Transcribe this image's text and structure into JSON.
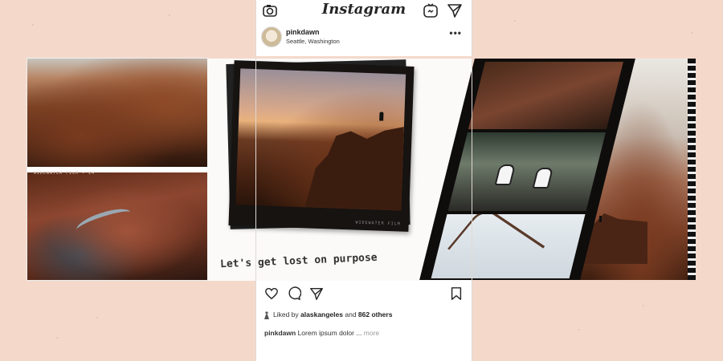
{
  "instagram": {
    "logo": "Instagram",
    "icons": {
      "camera": "camera-icon",
      "igtv": "igtv-icon",
      "direct": "direct-message-icon"
    },
    "post": {
      "username": "pinkdawn",
      "location": "Seattle, Washington",
      "more": "•••"
    },
    "actions": {
      "like": "heart-icon",
      "comment": "comment-icon",
      "share": "send-icon",
      "save": "bookmark-icon"
    },
    "likes": {
      "prefix": "Liked by",
      "user": "alaskangeles",
      "joiner": "and",
      "others": "862 others"
    },
    "caption": {
      "username": "pinkdawn",
      "text": "Lorem ipsum dolor ...",
      "more": "more"
    }
  },
  "collage": {
    "tagline": "Let's get lost on purpose",
    "film_caption": "WIDEWATER FILM • 24",
    "polaroid_stamp": "WIDEWATER FILM"
  },
  "colors": {
    "background": "#f4d9cb",
    "ink": "#262626",
    "muted": "#999999"
  }
}
